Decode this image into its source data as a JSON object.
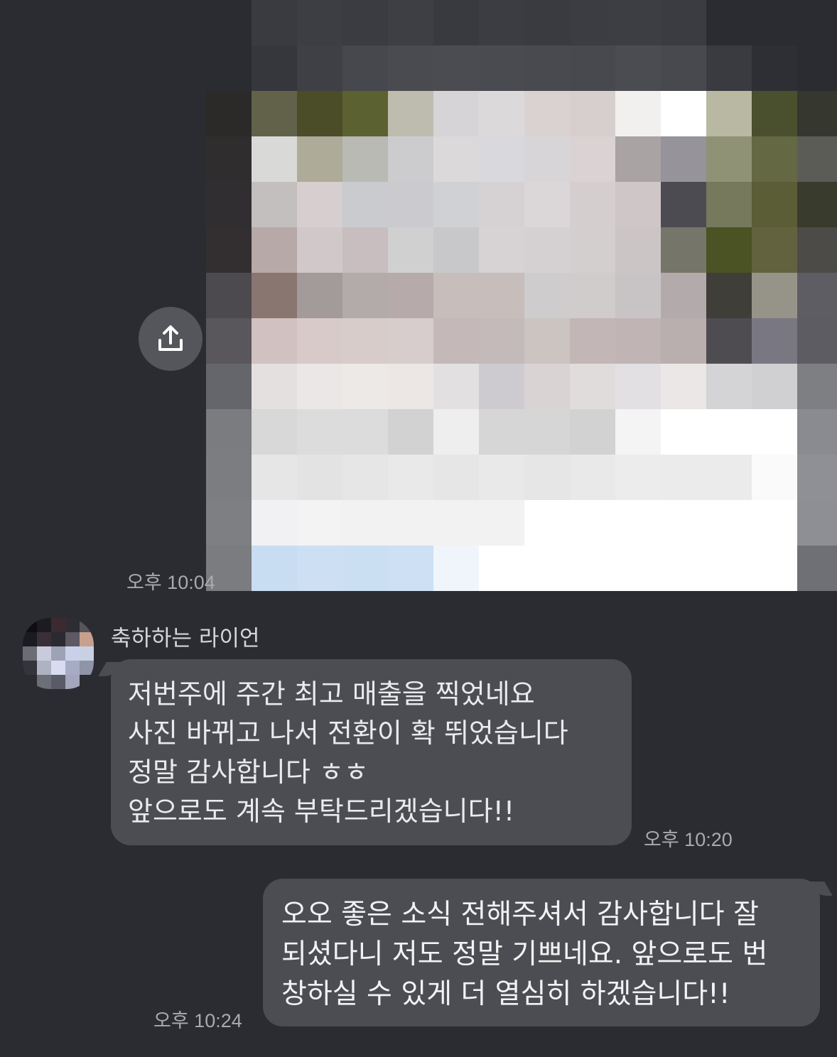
{
  "image_message": {
    "time": "오후 10:04",
    "share_icon": "share-upload-icon"
  },
  "incoming": {
    "sender_name": "축하하는 라이언",
    "lines": [
      "저번주에 주간 최고 매출을 찍었네요",
      "사진 바뀌고 나서 전환이 확 뛰었습니다",
      "정말 감사합니다 ㅎㅎ",
      "앞으로도 계속 부탁드리겠습니다!!"
    ],
    "time": "오후 10:20"
  },
  "outgoing": {
    "lines": [
      "오오 좋은 소식 전해주셔서 감사합니다 잘",
      "되셨다니 저도 정말 기쁘네요. 앞으로도 번",
      "창하실 수 있게 더 열심히 하겠습니다!!"
    ],
    "time": "오후 10:24"
  },
  "colors": {
    "background": "#2b2c31",
    "bubble": "#4c4d52",
    "time_text": "#a9aaae"
  }
}
